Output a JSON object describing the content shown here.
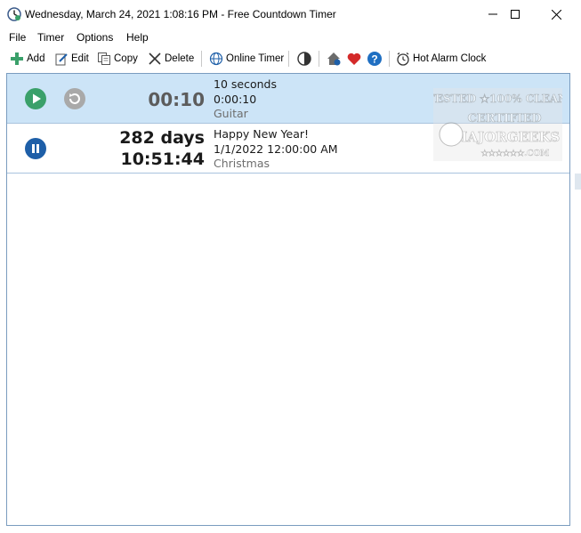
{
  "window": {
    "title": "Wednesday, March 24, 2021 1:08:16 PM - Free Countdown Timer",
    "controls": [
      "minimize",
      "maximize",
      "close"
    ]
  },
  "menu": {
    "items": [
      "File",
      "Timer",
      "Options",
      "Help"
    ]
  },
  "toolbar": {
    "add_label": "Add",
    "edit_label": "Edit",
    "copy_label": "Copy",
    "delete_label": "Delete",
    "online_timer_label": "Online Timer",
    "hot_alarm_clock_label": "Hot Alarm Clock",
    "icons": [
      "plus-icon",
      "edit-icon",
      "copy-icon",
      "delete-x-icon",
      "globe-icon",
      "contrast-icon",
      "home-icon",
      "heart-icon",
      "help-icon",
      "alarm-clock-icon"
    ]
  },
  "timers": [
    {
      "state": "stopped",
      "countdown": "00:10",
      "name": "10 seconds",
      "time": "0:00:10",
      "sound": "Guitar",
      "selected": true
    },
    {
      "state": "running",
      "countdown_days": "282 days",
      "countdown_time": "10:51:44",
      "name": "Happy New Year!",
      "time": "1/1/2022 12:00:00 AM",
      "sound": "Christmas",
      "selected": false
    }
  ],
  "watermark": {
    "line1": "TESTED ★100% CLEAN",
    "line2": "CERTIFIED",
    "line3": "MAJORGEEKS",
    "line4": "★★★★★★.COM"
  },
  "colors": {
    "selected_row": "#cce4f7",
    "play_green": "#3aa06a",
    "pause_blue": "#1e5fa8",
    "heart_red": "#d42a2a",
    "help_blue": "#1f6fc2"
  }
}
